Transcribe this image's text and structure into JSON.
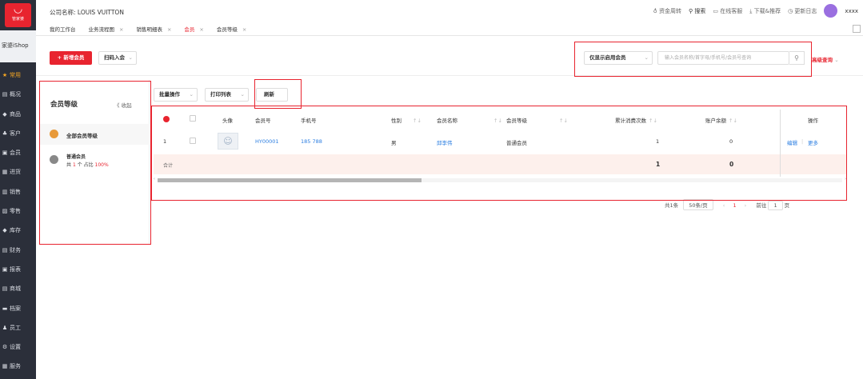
{
  "sidebar": {
    "logo_text": "管家婆",
    "brand": "家婆iShop",
    "items": [
      {
        "label": "常用",
        "icon": "star-icon",
        "glyph": "★"
      },
      {
        "label": "概况",
        "icon": "overview-icon",
        "glyph": "▤"
      },
      {
        "label": "商品",
        "icon": "goods-icon",
        "glyph": "◆"
      },
      {
        "label": "客户",
        "icon": "customer-icon",
        "glyph": "♣"
      },
      {
        "label": "会员",
        "icon": "member-icon",
        "glyph": "▣"
      },
      {
        "label": "进货",
        "icon": "purchase-icon",
        "glyph": "▦"
      },
      {
        "label": "销售",
        "icon": "sales-icon",
        "glyph": "▥"
      },
      {
        "label": "零售",
        "icon": "retail-icon",
        "glyph": "▨"
      },
      {
        "label": "库存",
        "icon": "stock-icon",
        "glyph": "◆"
      },
      {
        "label": "财务",
        "icon": "finance-icon",
        "glyph": "▤"
      },
      {
        "label": "报表",
        "icon": "report-icon",
        "glyph": "▣"
      },
      {
        "label": "商城",
        "icon": "mall-icon",
        "glyph": "▤"
      },
      {
        "label": "档案",
        "icon": "archive-icon",
        "glyph": "▬"
      },
      {
        "label": "员工",
        "icon": "staff-icon",
        "glyph": "♟"
      },
      {
        "label": "设置",
        "icon": "settings-icon",
        "glyph": "⚙"
      },
      {
        "label": "服务",
        "icon": "service-icon",
        "glyph": "▦"
      }
    ]
  },
  "topbar": {
    "company": "公司名称: LOUIS VUITTON",
    "funds": "资金周转",
    "search": "搜索",
    "online": "在线客服",
    "download": "下载&推荐",
    "changelog": "更新日志",
    "user": "xxxx"
  },
  "tabs": [
    {
      "label": "我的工作台",
      "closable": false
    },
    {
      "label": "业务流程图",
      "closable": true
    },
    {
      "label": "销售明细表",
      "closable": true
    },
    {
      "label": "会员",
      "closable": true,
      "active": true
    },
    {
      "label": "会员等级",
      "closable": true
    }
  ],
  "toolbar": {
    "add_member": "+ 新增会员",
    "scan_import": "扫码入会",
    "filter_select": "仅显示启用会员",
    "search_placeholder": "输入会员名称/首字母/手机号/会员号查询",
    "advanced": "高级查询"
  },
  "levels_panel": {
    "title": "会员等级",
    "collapse": "《 收起",
    "all_levels": "全部会员等级",
    "normal_name": "普通会员",
    "normal_stat_prefix": "共",
    "normal_count": "1",
    "normal_stat_mid": "个 占比",
    "normal_pct": "100%"
  },
  "table_toolbar": {
    "batch": "批量操作",
    "print": "打印列表",
    "refresh": "刷新"
  },
  "table": {
    "headers": {
      "avatar": "头像",
      "member_no": "会员号",
      "phone": "手机号",
      "gender": "性别",
      "name": "会员名称",
      "level": "会员等级",
      "consume": "累计消费次数",
      "balance": "账户余额",
      "actions": "操作"
    },
    "rows": [
      {
        "index": "1",
        "member_no": "HY00001",
        "phone": "185    788",
        "gender": "男",
        "name": "邱李伟",
        "level": "普通会员",
        "consume": "1",
        "balance": "0",
        "edit": "编辑",
        "more": "更多"
      }
    ],
    "totals": {
      "label": "合计",
      "consume": "1",
      "balance": "0"
    }
  },
  "pager": {
    "total": "共1条",
    "page_size": "50条/页",
    "page": "1",
    "goto_prefix": "前往",
    "goto_value": "1",
    "goto_suffix": "页"
  },
  "accent": "#e8242f"
}
